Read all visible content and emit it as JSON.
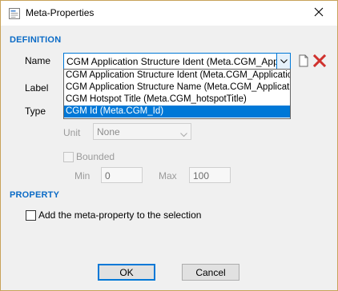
{
  "window": {
    "title": "Meta-Properties",
    "app_icon": "app-icon",
    "close_icon": "close-icon"
  },
  "definition": {
    "section_label": "DEFINITION",
    "name_label": "Name",
    "name_value": "CGM Application Structure Ident (Meta.CGM_Applicatic",
    "label_label": "Label",
    "type_label": "Type",
    "dropdown_options": [
      "CGM Application Structure Ident (Meta.CGM_ApplicationStr",
      "CGM Application Structure Name (Meta.CGM_ApplicationStr",
      "CGM Hotspot Title (Meta.CGM_hotspotTitle)",
      "CGM Id (Meta.CGM_Id)"
    ],
    "selected_option_index": 3,
    "new_icon": "new-document-icon",
    "delete_icon": "delete-x-icon",
    "unit_label": "Unit",
    "unit_value": "None",
    "bounded_label": "Bounded",
    "min_label": "Min",
    "min_value": "0",
    "max_label": "Max",
    "max_value": "100"
  },
  "property": {
    "section_label": "PROPERTY",
    "add_checkbox_label": "Add the meta-property to the selection",
    "add_checked": false
  },
  "buttons": {
    "ok": "OK",
    "cancel": "Cancel"
  },
  "colors": {
    "section_blue": "#0b6bc6",
    "selection_blue": "#0078d7",
    "delete_red": "#d0312d"
  }
}
